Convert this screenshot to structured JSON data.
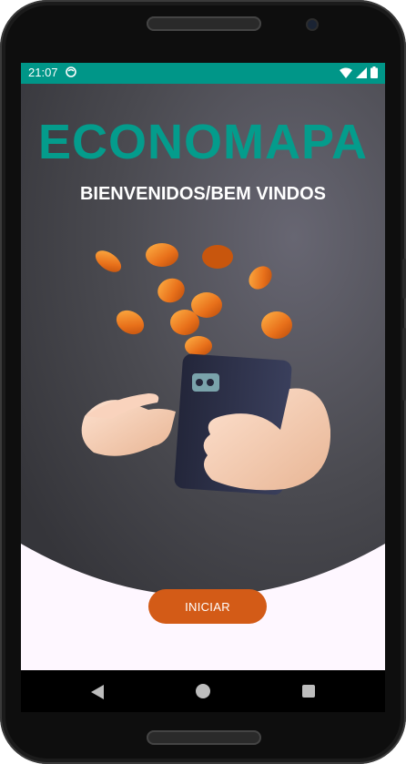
{
  "status_bar": {
    "time": "21:07",
    "background": "#009688",
    "icons": [
      "app-notification-icon",
      "wifi-icon",
      "signal-icon",
      "battery-icon"
    ]
  },
  "splash": {
    "title": "ECONOMAPA",
    "subtitle": "BIENVENIDOS/BEM VINDOS",
    "title_color": "#049c8c",
    "illustration": "hand-holding-phone-with-coins"
  },
  "actions": {
    "start_label": "INICIAR",
    "start_color": "#d35b17"
  },
  "nav_bar": {
    "icons": [
      "back-icon",
      "home-icon",
      "recents-icon"
    ]
  }
}
